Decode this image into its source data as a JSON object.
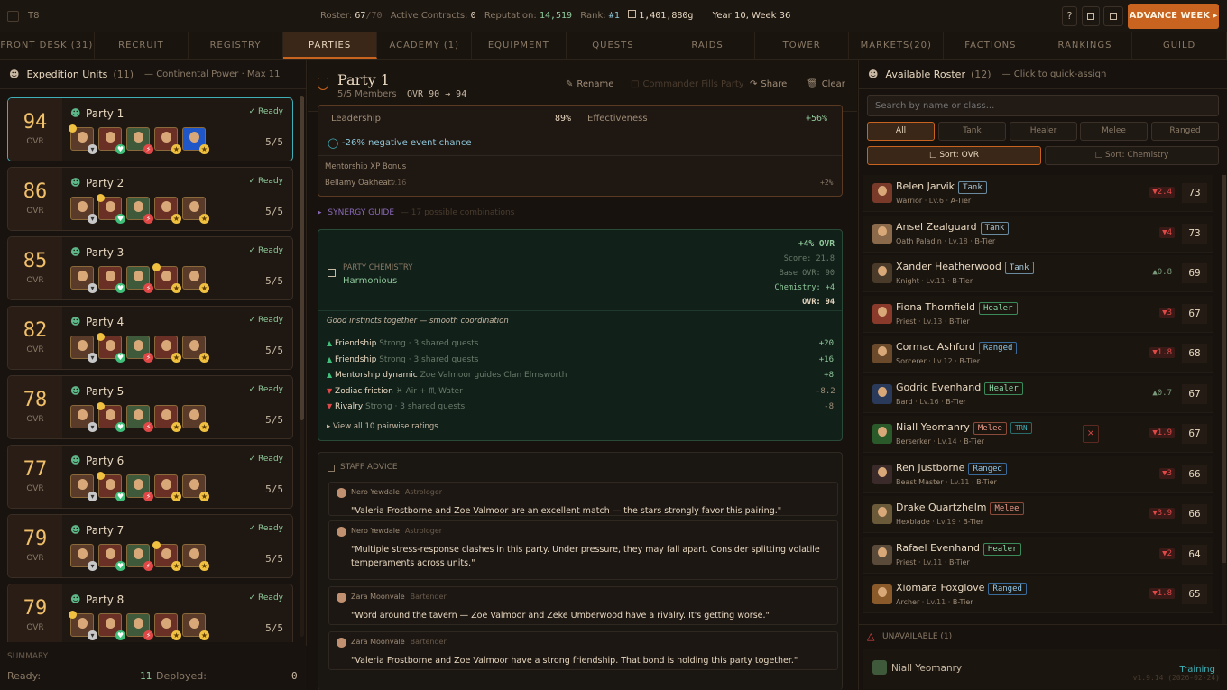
{
  "topbar": {
    "logo": "T8",
    "roster_label": "Roster:",
    "roster_value": "67",
    "roster_max": "/70",
    "contracts_label": "Active Contracts:",
    "contracts_value": "0",
    "reputation_label": "Reputation:",
    "reputation_value": "14,519",
    "rank_label": "Rank:",
    "rank_value": "#1",
    "gold_value": "1,401,880g",
    "date": "Year 10, Week 36",
    "help": "?",
    "advance_label": "ADVANCE WEEK ▸"
  },
  "tabs": [
    {
      "label": "FRONT DESK (31)"
    },
    {
      "label": "RECRUIT"
    },
    {
      "label": "REGISTRY"
    },
    {
      "label": "PARTIES"
    },
    {
      "label": "ACADEMY (1)"
    },
    {
      "label": "EQUIPMENT"
    },
    {
      "label": "QUESTS"
    },
    {
      "label": "RAIDS"
    },
    {
      "label": "TOWER"
    },
    {
      "label": "MARKETS(20)"
    },
    {
      "label": "FACTIONS"
    },
    {
      "label": "RANKINGS"
    },
    {
      "label": "GUILD"
    }
  ],
  "left": {
    "title": "Expedition Units",
    "count": "(11)",
    "subtitle": "— Continental Power · Max 11",
    "parties": [
      {
        "ovr": "94",
        "ovr_label": "OVR",
        "name": "Party 1",
        "status": "Ready",
        "members": "5/5"
      },
      {
        "ovr": "86",
        "ovr_label": "OVR",
        "name": "Party 2",
        "status": "Ready",
        "members": "5/5"
      },
      {
        "ovr": "85",
        "ovr_label": "OVR",
        "name": "Party 3",
        "status": "Ready",
        "members": "5/5"
      },
      {
        "ovr": "82",
        "ovr_label": "OVR",
        "name": "Party 4",
        "status": "Ready",
        "members": "5/5"
      },
      {
        "ovr": "78",
        "ovr_label": "OVR",
        "name": "Party 5",
        "status": "Ready",
        "members": "5/5"
      },
      {
        "ovr": "77",
        "ovr_label": "OVR",
        "name": "Party 6",
        "status": "Ready",
        "members": "5/5"
      },
      {
        "ovr": "79",
        "ovr_label": "OVR",
        "name": "Party 7",
        "status": "Ready",
        "members": "5/5"
      },
      {
        "ovr": "79",
        "ovr_label": "OVR",
        "name": "Party 8",
        "status": "Ready",
        "members": "5/5"
      }
    ],
    "summary_label": "SUMMARY",
    "ready_label": "Ready:",
    "ready_value": "11",
    "deployed_label": "Deployed:",
    "deployed_value": "0"
  },
  "center": {
    "title": "Party 1",
    "members": "5/5 Members",
    "ovr_line": "OVR 90 → 94",
    "rename": "Rename",
    "commander": "Commander Fills Party",
    "share": "Share",
    "clear": "Clear",
    "leadership_label": "Leadership",
    "leadership_value": "89%",
    "effectiveness_label": "Effectiveness",
    "effectiveness_value": "+56%",
    "event_chance": "-26% negative event chance",
    "mentorship_label": "Mentorship XP Bonus",
    "mentor_name": "Bellamy Oakheart",
    "mentor_level": "Lv.16",
    "mentor_bonus": "+2%",
    "synergy_label": "SYNERGY GUIDE",
    "synergy_sub": "— 17 possible combinations",
    "chem_title": "PARTY CHEMISTRY",
    "chem_state": "Harmonious",
    "chem_bonus": "+4% OVR",
    "chem_score": "Score: 21.8",
    "chem_base": "Base OVR: 90",
    "chem_chem": "Chemistry: +4",
    "chem_ovr": "OVR: 94",
    "chem_quote": "Good instincts together — smooth coordination",
    "bonds": [
      {
        "arrow": "▲",
        "type": "Friendship",
        "desc": "Strong · 3 shared quests",
        "value": "+20"
      },
      {
        "arrow": "▲",
        "type": "Friendship",
        "desc": "Strong · 3 shared quests",
        "value": "+16"
      },
      {
        "arrow": "▲",
        "type": "Mentorship dynamic",
        "desc": "Zoe Valmoor guides Clan Elmsworth",
        "value": "+8"
      },
      {
        "arrow": "▼",
        "type": "Zodiac friction",
        "desc": "♓ Air + ♏ Water",
        "value": "-8.2"
      },
      {
        "arrow": "▼",
        "type": "Rivalry",
        "desc": "Strong · 3 shared quests",
        "value": "-8"
      }
    ],
    "view_all": "▸ View all 10 pairwise ratings",
    "staff_title": "STAFF ADVICE",
    "advice": [
      {
        "who": "Nero Yewdale",
        "role": "Astrologer",
        "text": "\"Valeria Frostborne and Zoe Valmoor are an excellent match — the stars strongly favor this pairing.\""
      },
      {
        "who": "Nero Yewdale",
        "role": "Astrologer",
        "text": "\"Multiple stress-response clashes in this party. Under pressure, they may fall apart. Consider splitting volatile temperaments across units.\""
      },
      {
        "who": "Zara Moonvale",
        "role": "Bartender",
        "text": "\"Word around the tavern — Zoe Valmoor and Zeke Umberwood have a rivalry. It's getting worse.\""
      },
      {
        "who": "Zara Moonvale",
        "role": "Bartender",
        "text": "\"Valeria Frostborne and Zoe Valmoor have a strong friendship. That bond is holding this party together.\""
      }
    ]
  },
  "right": {
    "title": "Available Roster",
    "count": "(12)",
    "hint": "— Click to quick-assign",
    "search_placeholder": "Search by name or class...",
    "filters": [
      "All",
      "Tank",
      "Healer",
      "Melee",
      "Ranged"
    ],
    "sort_ovr": "□ Sort: OVR",
    "sort_chem": "□ Sort: Chemistry",
    "roster": [
      {
        "name": "Belen Jarvik",
        "role": "Tank",
        "cls": "Warrior",
        "lvl": "Lv.6",
        "tier": "A-Tier",
        "delta": "▼2.4",
        "ovr": "73"
      },
      {
        "name": "Ansel Zealguard",
        "role": "Tank",
        "cls": "Oath Paladin",
        "lvl": "Lv.18",
        "tier": "B-Tier",
        "delta": "▼4",
        "ovr": "73"
      },
      {
        "name": "Xander Heatherwood",
        "role": "Tank",
        "cls": "Knight",
        "lvl": "Lv.11",
        "tier": "B-Tier",
        "delta": "▲0.8",
        "ovr": "69"
      },
      {
        "name": "Fiona Thornfield",
        "role": "Healer",
        "cls": "Priest",
        "lvl": "Lv.13",
        "tier": "B-Tier",
        "delta": "▼3",
        "ovr": "67"
      },
      {
        "name": "Cormac Ashford",
        "role": "Ranged",
        "cls": "Sorcerer",
        "lvl": "Lv.12",
        "tier": "B-Tier",
        "delta": "▼1.8",
        "ovr": "68"
      },
      {
        "name": "Godric Evenhand",
        "role": "Healer",
        "cls": "Bard",
        "lvl": "Lv.16",
        "tier": "B-Tier",
        "delta": "▲0.7",
        "ovr": "67"
      },
      {
        "name": "Niall Yeomanry",
        "role": "Melee",
        "tag": "TRN",
        "cls": "Berserker",
        "lvl": "Lv.14",
        "tier": "B-Tier",
        "delta": "▼1.9",
        "ovr": "67"
      },
      {
        "name": "Ren Justborne",
        "role": "Ranged",
        "cls": "Beast Master",
        "lvl": "Lv.11",
        "tier": "B-Tier",
        "delta": "▼3",
        "ovr": "66"
      },
      {
        "name": "Drake Quartzhelm",
        "role": "Melee",
        "cls": "Hexblade",
        "lvl": "Lv.19",
        "tier": "B-Tier",
        "delta": "▼3.9",
        "ovr": "66"
      },
      {
        "name": "Rafael Evenhand",
        "role": "Healer",
        "cls": "Priest",
        "lvl": "Lv.11",
        "tier": "B-Tier",
        "delta": "▼2",
        "ovr": "64"
      },
      {
        "name": "Xiomara Foxglove",
        "role": "Ranged",
        "cls": "Archer",
        "lvl": "Lv.11",
        "tier": "B-Tier",
        "delta": "▼1.8",
        "ovr": "65"
      }
    ],
    "unavailable_label": "UNAVAILABLE (1)",
    "unavailable_name": "Niall Yeomanry",
    "unavailable_status": "Training",
    "version": "v1.9.14 (2026-02-24)"
  },
  "colors": {
    "accent": "#c8641f",
    "gold": "#f0c06a",
    "teal": "#3fb0b8",
    "green": "#8fc99a",
    "red": "#e04848"
  }
}
